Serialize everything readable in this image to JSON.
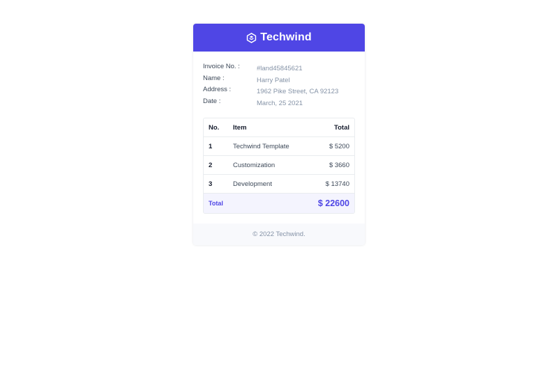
{
  "brand": {
    "name": "Techwind",
    "icon": "techwind-logo-icon",
    "accent_color": "#4f46e5"
  },
  "invoice": {
    "fields": [
      {
        "label": "Invoice No. :",
        "value": "#land45845621"
      },
      {
        "label": "Name :",
        "value": "Harry Patel"
      },
      {
        "label": "Address :",
        "value": "1962 Pike Street, CA 92123"
      },
      {
        "label": "Date :",
        "value": "March, 25 2021"
      }
    ]
  },
  "table": {
    "headers": {
      "no": "No.",
      "item": "Item",
      "total": "Total"
    },
    "rows": [
      {
        "no": "1",
        "item": "Techwind Template",
        "total": "$ 5200"
      },
      {
        "no": "2",
        "item": "Customization",
        "total": "$ 3660"
      },
      {
        "no": "3",
        "item": "Development",
        "total": "$ 13740"
      }
    ],
    "total_label": "Total",
    "total_value": "$ 22600"
  },
  "footer": {
    "text": "© 2022 Techwind."
  }
}
